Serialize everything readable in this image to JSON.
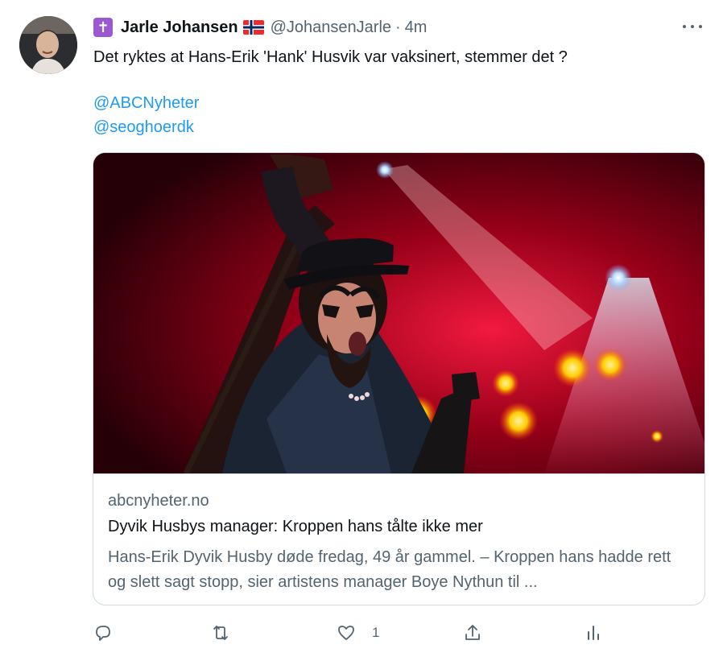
{
  "tweet": {
    "author": {
      "name": "Jarle Johansen",
      "handle": "@JohansenJarle",
      "badge_icon": "latin-cross-icon",
      "flag_icon": "norway-flag-icon",
      "avatar_icon": "profile-avatar"
    },
    "separator": "·",
    "time": "4m",
    "text": "Det ryktes at Hans-Erik 'Hank' Husvik var vaksinert, stemmer det ?",
    "mentions": [
      "@ABCNyheter",
      "@seoghoerdk"
    ],
    "more_icon": "more-options-icon",
    "card": {
      "image_icon": "concert-performer-image",
      "domain": "abcnyheter.no",
      "title": "Dyvik Husbys manager: Kroppen hans tålte ikke mer",
      "description": "Hans-Erik Dyvik Husby døde fredag, 49 år gammel. – Kroppen hans hadde rett og slett sagt stopp, sier artistens manager Boye Nythun til ..."
    },
    "actions": {
      "reply_icon": "reply-icon",
      "retweet_icon": "retweet-icon",
      "like_icon": "heart-icon",
      "like_count": "1",
      "share_icon": "share-icon",
      "analytics_icon": "analytics-icon"
    },
    "colors": {
      "link": "#1d9bf0",
      "secondary_text": "#536471",
      "border": "#cfd9de",
      "badge": "#9b59d0"
    }
  }
}
